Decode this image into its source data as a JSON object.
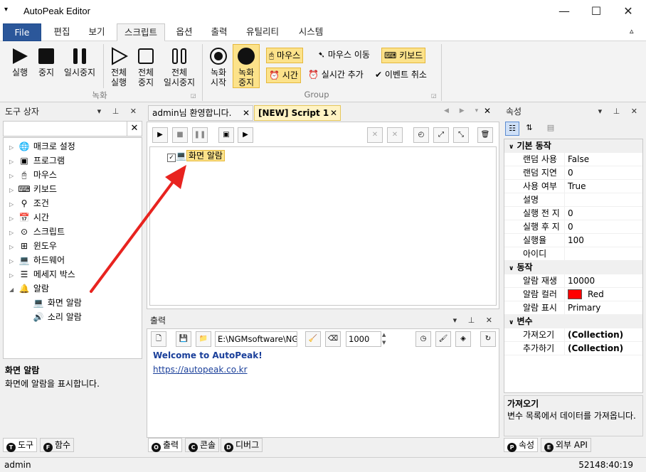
{
  "window": {
    "title": "AutoPeak Editor",
    "minimize": "—",
    "maximize": "☐",
    "close": "✕",
    "qat": "▾"
  },
  "ribbon_tabs": [
    "File",
    "편집",
    "보기",
    "스크립트",
    "옵션",
    "출력",
    "유틸리티",
    "시스템"
  ],
  "ribbon": {
    "collapse": "▵",
    "record_group": {
      "label": "녹화",
      "run": "실행",
      "stop": "중지",
      "pause": "일시중지",
      "all_run": [
        "전체",
        "실행"
      ],
      "all_stop": [
        "전체",
        "중지"
      ],
      "all_pause": [
        "전체",
        "일시중지"
      ]
    },
    "group": {
      "label": "Group",
      "rec_start": [
        "녹화",
        "시작"
      ],
      "rec_stop": [
        "녹화",
        "중지"
      ],
      "mouse": "마우스",
      "mouse_move": "마우스 이동",
      "keyboard": "키보드",
      "time": "시간",
      "realtime_add": "실시간 추가",
      "event_cancel": "이벤트 취소"
    }
  },
  "toolbox": {
    "title": "도구 상자",
    "search_placeholder": "",
    "clear": "✕",
    "items": [
      "매크로 설정",
      "프로그램",
      "마우스",
      "키보드",
      "조건",
      "시간",
      "스크립트",
      "윈도우",
      "하드웨어",
      "메세지 박스",
      "알람"
    ],
    "children": [
      "화면 알람",
      "소리 알람"
    ],
    "desc_title": "화면 알람",
    "desc_text": "화면에 알람을 표시합니다.",
    "tabs": [
      {
        "key": "T",
        "label": "도구"
      },
      {
        "key": "F",
        "label": "함수"
      }
    ]
  },
  "editor": {
    "tabs": [
      "admin님 환영합니다.",
      "[NEW] Script 1"
    ],
    "node": "화면 알람"
  },
  "output": {
    "title": "출력",
    "path": "E:\\NGMsoftware\\NG",
    "number": "1000",
    "line1": "Welcome to AutoPeak!",
    "line2": "https://autopeak.co.kr",
    "tabs": [
      {
        "key": "O",
        "label": "출력"
      },
      {
        "key": "C",
        "label": "콘솔"
      },
      {
        "key": "D",
        "label": "디버그"
      }
    ]
  },
  "properties": {
    "title": "속성",
    "categories": [
      {
        "name": "기본 동작",
        "rows": [
          [
            "랜덤 사용",
            "False"
          ],
          [
            "랜덤 지연",
            "0"
          ],
          [
            "사용 여부",
            "True"
          ],
          [
            "설명",
            ""
          ],
          [
            "실행 전 지",
            "0"
          ],
          [
            "실행 후 지",
            "0"
          ],
          [
            "실행율",
            "100"
          ],
          [
            "아이디",
            ""
          ]
        ]
      },
      {
        "name": "동작",
        "rows": [
          [
            "알람 재생",
            "10000"
          ],
          [
            "알람 컬러",
            "Red"
          ],
          [
            "알람 표시",
            "Primary"
          ]
        ]
      },
      {
        "name": "변수",
        "rows": [
          [
            "가져오기",
            "(Collection)"
          ],
          [
            "추가하기",
            "(Collection)"
          ]
        ]
      }
    ],
    "color_swatch": "#ff0000",
    "desc_title": "가져오기",
    "desc_text": "변수 목록에서 데이터를 가져옵니다.",
    "tabs": [
      {
        "key": "P",
        "label": "속성"
      },
      {
        "key": "E",
        "label": "외부 API"
      }
    ]
  },
  "status": {
    "user": "admin",
    "time": "52148:40:19"
  },
  "colors": {
    "accent": "#2b579a",
    "highlight": "#fce28a",
    "arrow": "#e8231f"
  }
}
